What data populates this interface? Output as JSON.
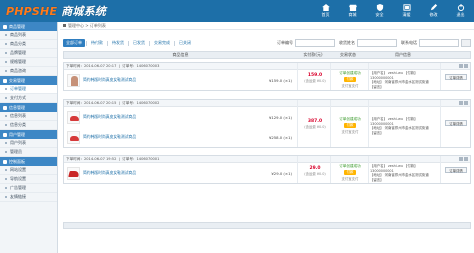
{
  "app": {
    "logo_main": "PHPSHE",
    "logo_suffix": "商城系统",
    "colors": {
      "brand": "#1d6fa8",
      "accent": "#ff7a1a",
      "price": "#d9002b",
      "paybadge": "#ffb400",
      "status_green": "#3b9a2c"
    }
  },
  "topnav": [
    {
      "label": "首页",
      "icon": "home-icon"
    },
    {
      "label": "商城",
      "icon": "shop-icon"
    },
    {
      "label": "安全",
      "icon": "shield-icon"
    },
    {
      "label": "清缓",
      "icon": "refresh-icon"
    },
    {
      "label": "修改",
      "icon": "edit-icon"
    },
    {
      "label": "退出",
      "icon": "power-icon"
    }
  ],
  "sidebar": {
    "groups": [
      {
        "title": "商品管理",
        "items": [
          "商品列表",
          "商品分类",
          "品牌管理",
          "规格管理",
          "商品咨询"
        ]
      },
      {
        "title": "交易管理",
        "items": [
          "订单管理",
          "支付方式"
        ]
      },
      {
        "title": "信息管理",
        "items": [
          "信息列表",
          "信息分类"
        ]
      },
      {
        "title": "用户管理",
        "items": [
          "用户列表",
          "管理员"
        ]
      },
      {
        "title": "控制面板",
        "items": [
          "网站设置",
          "导航设置",
          "广告管理",
          "友情链接"
        ]
      }
    ]
  },
  "breadcrumb": {
    "root": "管理中心",
    "current": "订单列表"
  },
  "tabs": [
    "全部订单",
    "待付款",
    "待发货",
    "已发货",
    "交易完成",
    "已关闭"
  ],
  "filters": {
    "order_id_label": "订单编号",
    "buyer_label": "收货姓名",
    "phone_label": "联系电话",
    "search_button": ""
  },
  "table_headers": {
    "product": "商品信息",
    "total": "实付款(元)",
    "status": "交易状态",
    "user": "用户信息"
  },
  "orders": [
    {
      "time": "下单时间：2014-06-07 20:17",
      "order_no": "订单号：1406070003",
      "products": [
        {
          "name": "简约韩版时尚真皮女鞋测试商品",
          "price": "¥159.0 (×1)",
          "thumb": "person"
        }
      ],
      "total": "159.0",
      "total_sub": "(含运费 ¥0.0)",
      "status": "订单创建成功",
      "pay_label": "付款",
      "pay_method": "支付宝支付",
      "user_lines": [
        "【用户名】 zeshi-wu  【付款】13000000001",
        "【地址】 河南省郑州市金水区测试街道",
        "【留言】"
      ],
      "op": "订单详情"
    },
    {
      "time": "下单时间：2014-06-07 20:15",
      "order_no": "订单号：1406070002",
      "products": [
        {
          "name": "简约韩版时尚真皮女鞋测试商品",
          "price": "¥129.0 (×1)",
          "thumb": "shoe"
        },
        {
          "name": "简约韩版时尚真皮女鞋测试商品",
          "price": "¥258.0 (×1)",
          "thumb": "shoe"
        }
      ],
      "total": "387.0",
      "total_sub": "(含运费 ¥0.0)",
      "status": "订单创建成功",
      "pay_label": "付款",
      "pay_method": "支付宝支付",
      "user_lines": [
        "【用户名】 zeshi-wu  【付款】13000000001",
        "【地址】 河南省郑州市金水区测试街道",
        "【留言】"
      ],
      "op": "订单详情"
    },
    {
      "time": "下单时间：2014-06-07 19:52",
      "order_no": "订单号：1406070001",
      "products": [
        {
          "name": "简约韩版时尚真皮女鞋测试商品",
          "price": "¥29.0 (×1)",
          "thumb": "shoe2"
        }
      ],
      "total": "29.0",
      "total_sub": "(含运费 ¥0.0)",
      "status": "订单创建成功",
      "pay_label": "付款",
      "pay_method": "支付宝支付",
      "user_lines": [
        "【用户名】 zeshi-wu  【付款】13000000001",
        "【地址】 河南省郑州市金水区测试街道",
        "【留言】"
      ],
      "op": "订单详情"
    }
  ]
}
